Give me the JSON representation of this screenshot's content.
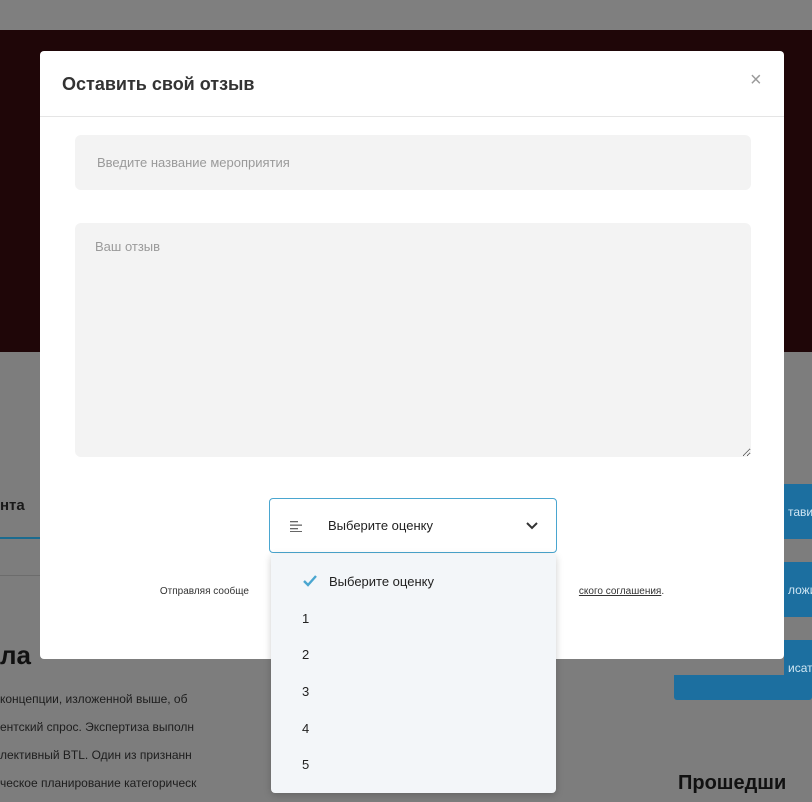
{
  "background": {
    "tab_fragment": "нта",
    "heading_fragment": "ла",
    "paragraph_lines": [
      "концепции, изложенной выше, об",
      "ентский спрос. Экспертиза выполн",
      "лективный BTL. Один из признанн",
      "ческое планирование категорическ"
    ],
    "right_buttons": [
      "тавить",
      "ложить",
      "исать"
    ],
    "past_heading": "Прошедши"
  },
  "modal": {
    "title": "Оставить свой отзыв",
    "close_symbol": "×",
    "event_placeholder": "Введите название мероприятия",
    "review_placeholder": "Ваш отзыв",
    "rating_select": {
      "selected": "Выберите оценку",
      "options": [
        "Выберите оценку",
        "1",
        "2",
        "3",
        "4",
        "5"
      ]
    },
    "consent_prefix": "Отправляя сообще",
    "consent_link": "ского соглашения",
    "consent_suffix": "."
  },
  "colors": {
    "hero": "#1f0608",
    "accent": "#4aa6d0",
    "button_blue": "#1c6fa0",
    "check": "#4aa6d0"
  }
}
